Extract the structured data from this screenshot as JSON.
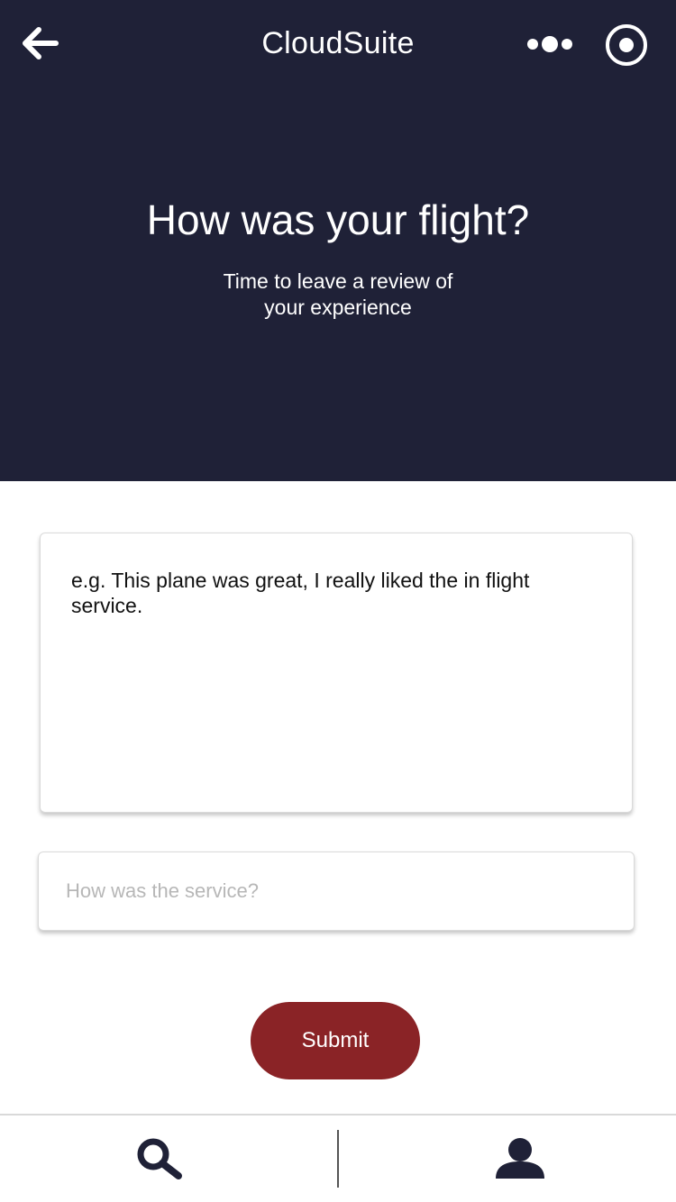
{
  "app": {
    "title": "CloudSuite",
    "header_bg": "#1f2137",
    "accent": "#8a2326"
  },
  "topbar": {
    "back_icon": "arrow-left-icon",
    "more_icon": "more-dots-icon",
    "record_icon": "record-circle-icon"
  },
  "hero": {
    "title": "How was your flight?",
    "subtitle": "Time to leave a review of your experience"
  },
  "form": {
    "review_text": "e.g. This plane was great, I really liked the in flight service.",
    "service_placeholder": "How was the service?",
    "service_value": "",
    "submit_label": "Submit"
  },
  "bottom_nav": {
    "items": [
      {
        "icon": "search-icon"
      },
      {
        "icon": "user-icon"
      }
    ]
  }
}
